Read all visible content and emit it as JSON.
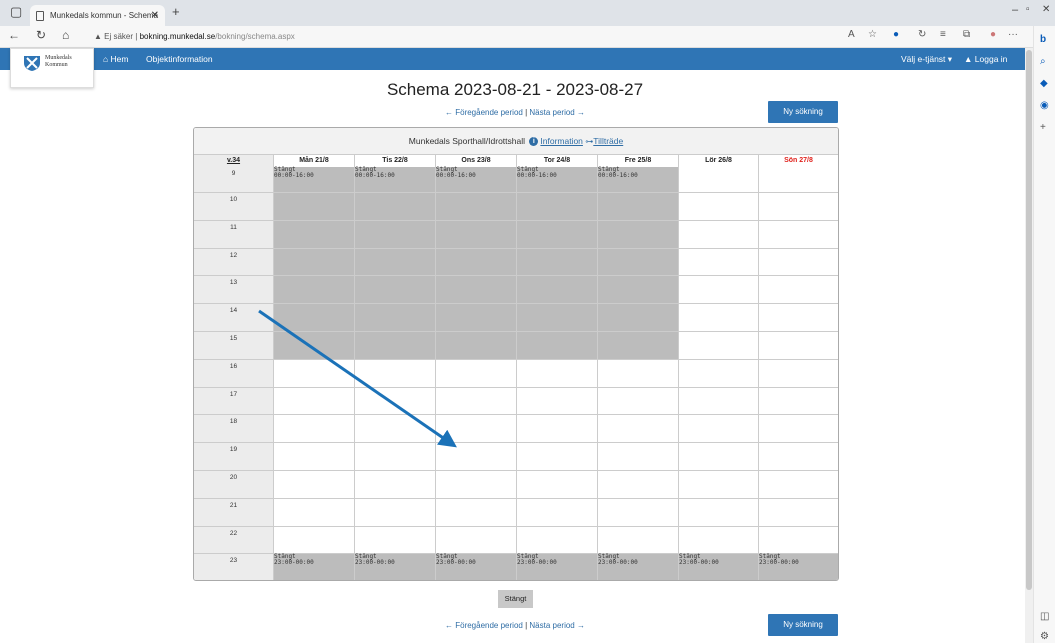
{
  "browser": {
    "tab_title": "Munkedals kommun - Schema",
    "url_warning": "Ej säker",
    "url_host": "bokning.munkedal.se",
    "url_path": "/bokning/schema.aspx"
  },
  "site": {
    "logo_text": "Munkedals Kommun",
    "nav": {
      "home": "Hem",
      "object_info": "Objektinformation",
      "service": "Välj e-tjänst ▾",
      "login": "Logga in"
    }
  },
  "title": "Schema 2023-08-21 - 2023-08-27",
  "periods": {
    "prev": "Föregående period",
    "sep": "|",
    "next": "Nästa period"
  },
  "new_search": "Ny sökning",
  "facility": {
    "name": "Munkedals Sporthall/Idrottshall",
    "info": "Information",
    "access": "Tillträde"
  },
  "schedule": {
    "week": "v.34",
    "days": [
      "Mån 21/8",
      "Tis 22/8",
      "Ons 23/8",
      "Tor 24/8",
      "Fre 25/8",
      "Lör 26/8",
      "Sön 27/8"
    ],
    "hours": [
      "9",
      "10",
      "11",
      "12",
      "13",
      "14",
      "15",
      "16",
      "17",
      "18",
      "19",
      "20",
      "21",
      "22",
      "23"
    ],
    "closed_label": "Stängt",
    "morning_time": "00:00-16:00",
    "evening_time": "23:00-00:00"
  },
  "legend": {
    "closed": "Stängt"
  },
  "colors": {
    "nav": "#2f75b5",
    "closed": "#bcbcbc",
    "sunday": "#e0201b",
    "arrow": "#1b72b8"
  }
}
